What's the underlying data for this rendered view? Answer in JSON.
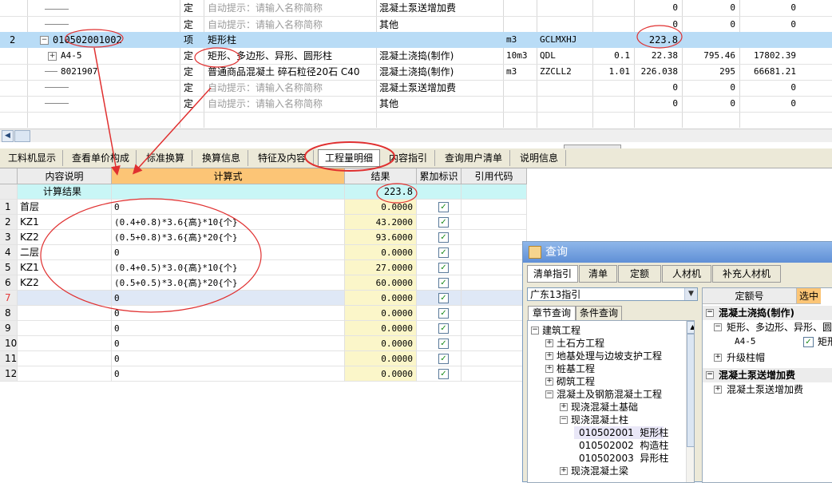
{
  "top_grid": {
    "rows": [
      {
        "type": "定",
        "name": "自动提示：请输入名称简称",
        "feature": "混凝土泵送增加费",
        "unit": "",
        "code": "",
        "qty": "",
        "val1": "0",
        "val2": "0",
        "val3": "0",
        "hint": true
      },
      {
        "type": "定",
        "name": "自动提示：请输入名称简称",
        "feature": "其他",
        "unit": "",
        "code": "",
        "qty": "",
        "val1": "0",
        "val2": "0",
        "val3": "0",
        "hint": true
      },
      {
        "num": "2",
        "code_no": "010502001002",
        "type": "项",
        "name": "矩形柱",
        "feature": "",
        "unit": "m3",
        "code": "GCLMXHJ",
        "qty": "",
        "val1": "223.8",
        "val2": "",
        "val3": ""
      },
      {
        "code_no": "A4-5",
        "type": "定",
        "name": "矩形、多边形、异形、圆形柱",
        "feature": "混凝土浇捣(制作)",
        "unit": "10m3",
        "code": "QDL",
        "qty": "0.1",
        "val1": "22.38",
        "val2": "795.46",
        "val3": "17802.39"
      },
      {
        "code_no": "8021907",
        "type": "定",
        "name": "普通商品混凝土 碎石粒径20石 C40",
        "feature": "混凝土浇捣(制作)",
        "unit": "m3",
        "code": "ZZCLL2",
        "qty": "1.01",
        "val1": "226.038",
        "val2": "295",
        "val3": "66681.21"
      },
      {
        "type": "定",
        "name": "自动提示：请输入名称简称",
        "feature": "混凝土泵送增加费",
        "unit": "",
        "code": "",
        "qty": "",
        "val1": "0",
        "val2": "0",
        "val3": "0",
        "hint": true
      },
      {
        "type": "定",
        "name": "自动提示：请输入名称简称",
        "feature": "其他",
        "unit": "",
        "code": "",
        "qty": "",
        "val1": "0",
        "val2": "0",
        "val3": "0",
        "hint": true
      }
    ]
  },
  "tabs": [
    "工料机显示",
    "查看单价构成",
    "标准换算",
    "换算信息",
    "特征及内容",
    "工程量明细",
    "内容指引",
    "查询用户清单",
    "说明信息"
  ],
  "active_tab": "工程量明细",
  "detail": {
    "headers": {
      "desc": "内容说明",
      "formula": "计算式",
      "result": "结果",
      "accum": "累加标识",
      "ref": "引用代码"
    },
    "summary_label": "计算结果",
    "summary_value": "223.8",
    "rows": [
      {
        "n": "1",
        "desc": "首层",
        "formula": "0",
        "result": "0.0000",
        "checked": true
      },
      {
        "n": "2",
        "desc": "KZ1",
        "formula": "(0.4+0.8)*3.6{高}*10{个}",
        "result": "43.2000",
        "checked": true
      },
      {
        "n": "3",
        "desc": "KZ2",
        "formula": "(0.5+0.8)*3.6{高}*20{个}",
        "result": "93.6000",
        "checked": true
      },
      {
        "n": "4",
        "desc": "二层",
        "formula": "0",
        "result": "0.0000",
        "checked": true
      },
      {
        "n": "5",
        "desc": "KZ1",
        "formula": "(0.4+0.5)*3.0{高}*10{个}",
        "result": "27.0000",
        "checked": true
      },
      {
        "n": "6",
        "desc": "KZ2",
        "formula": "(0.5+0.5)*3.0{高}*20{个}",
        "result": "60.0000",
        "checked": true
      },
      {
        "n": "7",
        "desc": "",
        "formula": "0",
        "result": "0.0000",
        "checked": true,
        "current": true
      },
      {
        "n": "8",
        "desc": "",
        "formula": "0",
        "result": "0.0000",
        "checked": true
      },
      {
        "n": "9",
        "desc": "",
        "formula": "0",
        "result": "0.0000",
        "checked": true
      },
      {
        "n": "10",
        "desc": "",
        "formula": "0",
        "result": "0.0000",
        "checked": true
      },
      {
        "n": "11",
        "desc": "",
        "formula": "0",
        "result": "0.0000",
        "checked": true
      },
      {
        "n": "12",
        "desc": "",
        "formula": "0",
        "result": "0.0000",
        "checked": true
      }
    ]
  },
  "query": {
    "title": "查询",
    "tabs": [
      "清单指引",
      "清单",
      "定额",
      "人材机",
      "补充人材机"
    ],
    "combo_value": "广东13指引",
    "subtabs": [
      "章节查询",
      "条件查询"
    ],
    "tree": [
      {
        "label": "建筑工程",
        "sign": "−",
        "indent": 0
      },
      {
        "label": "土石方工程",
        "sign": "+",
        "indent": 1
      },
      {
        "label": "地基处理与边坡支护工程",
        "sign": "+",
        "indent": 1
      },
      {
        "label": "桩基工程",
        "sign": "+",
        "indent": 1
      },
      {
        "label": "砌筑工程",
        "sign": "+",
        "indent": 1
      },
      {
        "label": "混凝土及钢筋混凝土工程",
        "sign": "−",
        "indent": 1
      },
      {
        "label": "现浇混凝土基础",
        "sign": "+",
        "indent": 2
      },
      {
        "label": "现浇混凝土柱",
        "sign": "−",
        "indent": 2
      },
      {
        "label": "010502001  矩形柱",
        "sign": "",
        "indent": 3,
        "selected": true
      },
      {
        "label": "010502002  构造柱",
        "sign": "",
        "indent": 3
      },
      {
        "label": "010502003  异形柱",
        "sign": "",
        "indent": 3
      },
      {
        "label": "现浇混凝土梁",
        "sign": "+",
        "indent": 2
      }
    ],
    "right": {
      "col_header": "定额号",
      "select_header": "选中",
      "group1": "混凝土浇捣(制作)",
      "item1": "矩形、多边形、异形、圆",
      "sub_code": "A4-5",
      "sub_name": "矩形",
      "item2": "升级柱帽",
      "group2": "混凝土泵送增加费",
      "item3": "混凝土泵送增加费"
    }
  },
  "colors": {
    "selected_row": "#b9dcf6",
    "header_orange": "#fcc576",
    "result_bg": "#fbf6c9",
    "summary_cyan": "#c9f6f6",
    "annotation_red": "#e03030"
  }
}
